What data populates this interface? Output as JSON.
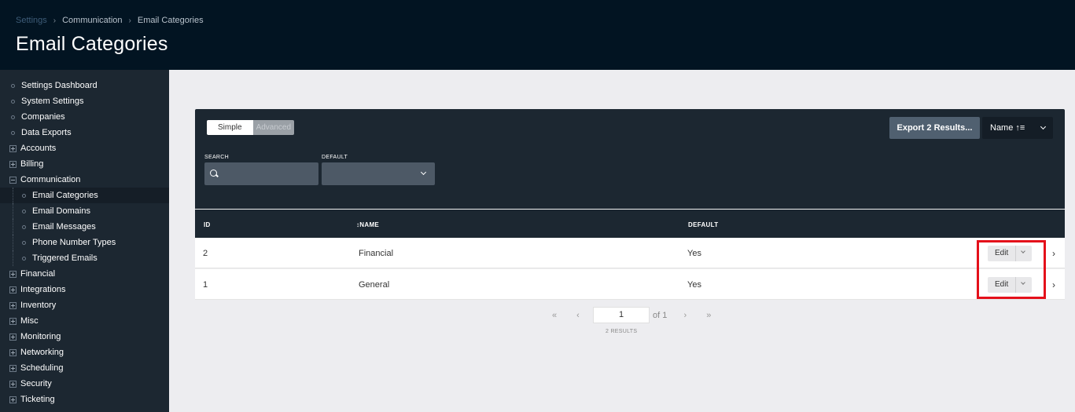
{
  "header": {
    "breadcrumb": [
      "Settings",
      "Communication",
      "Email Categories"
    ],
    "title": "Email Categories"
  },
  "sidebar": {
    "items": [
      {
        "label": "Settings Dashboard",
        "kind": "bullet"
      },
      {
        "label": "System Settings",
        "kind": "bullet"
      },
      {
        "label": "Companies",
        "kind": "bullet"
      },
      {
        "label": "Data Exports",
        "kind": "bullet"
      },
      {
        "label": "Accounts",
        "kind": "plus"
      },
      {
        "label": "Billing",
        "kind": "plus"
      },
      {
        "label": "Communication",
        "kind": "minus"
      },
      {
        "label": "Email Categories",
        "kind": "sub",
        "active": true
      },
      {
        "label": "Email Domains",
        "kind": "sub"
      },
      {
        "label": "Email Messages",
        "kind": "sub"
      },
      {
        "label": "Phone Number Types",
        "kind": "sub"
      },
      {
        "label": "Triggered Emails",
        "kind": "sub"
      },
      {
        "label": "Financial",
        "kind": "plus"
      },
      {
        "label": "Integrations",
        "kind": "plus"
      },
      {
        "label": "Inventory",
        "kind": "plus"
      },
      {
        "label": "Misc",
        "kind": "plus"
      },
      {
        "label": "Monitoring",
        "kind": "plus"
      },
      {
        "label": "Networking",
        "kind": "plus"
      },
      {
        "label": "Scheduling",
        "kind": "plus"
      },
      {
        "label": "Security",
        "kind": "plus"
      },
      {
        "label": "Ticketing",
        "kind": "plus"
      }
    ]
  },
  "filters": {
    "mode_simple": "Simple",
    "mode_advanced": "Advanced",
    "search_label": "SEARCH",
    "default_label": "DEFAULT",
    "export_label": "Export 2 Results...",
    "sort_label": "Name ↑≡"
  },
  "table": {
    "columns": [
      "ID",
      "↕NAME",
      "DEFAULT"
    ],
    "rows": [
      {
        "id": "2",
        "name": "Financial",
        "default": "Yes",
        "action": "Edit"
      },
      {
        "id": "1",
        "name": "General",
        "default": "Yes",
        "action": "Edit"
      }
    ]
  },
  "pagination": {
    "first": "«",
    "prev": "‹",
    "page": "1",
    "of_text": "of 1",
    "next": "›",
    "last": "»",
    "results": "2 RESULTS"
  },
  "colors": {
    "header_bg": "#021422",
    "sidebar_bg": "#1c2731",
    "highlight": "#e4101a"
  }
}
